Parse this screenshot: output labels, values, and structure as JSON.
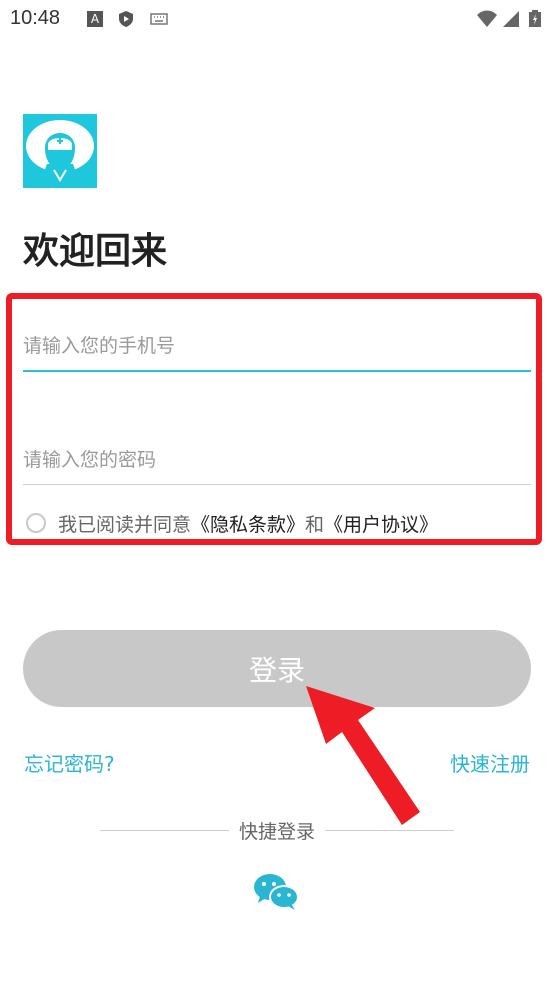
{
  "status_bar": {
    "time": "10:48"
  },
  "login": {
    "title": "欢迎回来",
    "phone_placeholder": "请输入您的手机号",
    "password_placeholder": "请输入您的密码",
    "agree_prefix": "我已阅读并同意",
    "privacy_link": "《隐私条款》",
    "and_text": "和",
    "user_agreement_link": "《用户协议》",
    "login_button": "登录",
    "forgot_password": "忘记密码?",
    "quick_register": "快速注册",
    "quick_login_label": "快捷登录"
  },
  "colors": {
    "accent": "#29b6d3",
    "highlight": "#ee1c25",
    "button_disabled": "#c8c8c8"
  },
  "icons": [
    "app-logo-icon",
    "wifi-icon",
    "signal-icon",
    "battery-icon",
    "wechat-icon"
  ]
}
